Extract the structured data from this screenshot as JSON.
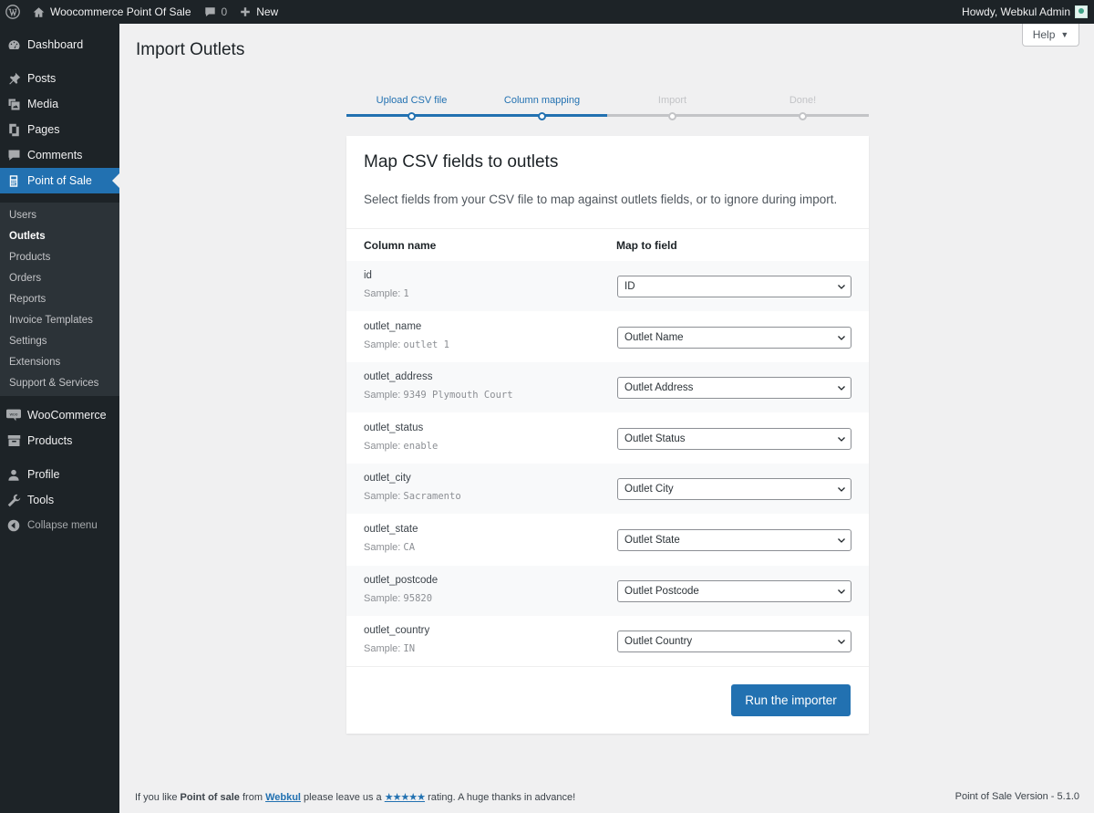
{
  "colors": {
    "accent": "#2271b1",
    "menu_bg": "#1d2327",
    "submenu_bg": "#2c3338",
    "page_bg": "#f0f0f1",
    "inactive": "#c3c4c7"
  },
  "adminbar": {
    "wp_logo_icon": "wordpress-icon",
    "site_name": "Woocommerce Point Of Sale",
    "comments_count": "0",
    "new_label": "New",
    "greeting": "Howdy, Webkul Admin"
  },
  "sidebar": {
    "dashboard": "Dashboard",
    "posts": "Posts",
    "media": "Media",
    "pages": "Pages",
    "comments": "Comments",
    "point_of_sale": "Point of Sale",
    "submenu": [
      "Users",
      "Outlets",
      "Products",
      "Orders",
      "Reports",
      "Invoice Templates",
      "Settings",
      "Extensions",
      "Support & Services"
    ],
    "woocommerce": "WooCommerce",
    "products": "Products",
    "profile": "Profile",
    "tools": "Tools",
    "collapse": "Collapse menu"
  },
  "page": {
    "title": "Import Outlets",
    "help": "Help"
  },
  "steps": [
    {
      "label": "Upload CSV file",
      "state": "done"
    },
    {
      "label": "Column mapping",
      "state": "active"
    },
    {
      "label": "Import",
      "state": "pending"
    },
    {
      "label": "Done!",
      "state": "pending"
    }
  ],
  "card": {
    "heading": "Map CSV fields to outlets",
    "description": "Select fields from your CSV file to map against outlets fields, or to ignore during import.",
    "col_name_header": "Column name",
    "map_header": "Map to field",
    "sample_prefix": "Sample:",
    "rows": [
      {
        "name": "id",
        "sample": "1",
        "field": "ID"
      },
      {
        "name": "outlet_name",
        "sample": "outlet 1",
        "field": "Outlet Name"
      },
      {
        "name": "outlet_address",
        "sample": "9349 Plymouth Court",
        "field": "Outlet Address"
      },
      {
        "name": "outlet_status",
        "sample": "enable",
        "field": "Outlet Status"
      },
      {
        "name": "outlet_city",
        "sample": "Sacramento",
        "field": "Outlet City"
      },
      {
        "name": "outlet_state",
        "sample": "CA",
        "field": "Outlet State"
      },
      {
        "name": "outlet_postcode",
        "sample": "95820",
        "field": "Outlet Postcode"
      },
      {
        "name": "outlet_country",
        "sample": "IN",
        "field": "Outlet Country"
      }
    ],
    "run_button": "Run the importer"
  },
  "footer": {
    "text1": "If you like ",
    "product": "Point of sale",
    "text2": " from ",
    "company": "Webkul",
    "text3": " please leave us a ",
    "stars": "★★★★★",
    "text4": " rating. A huge thanks in advance!",
    "version": "Point of Sale Version - 5.1.0"
  }
}
